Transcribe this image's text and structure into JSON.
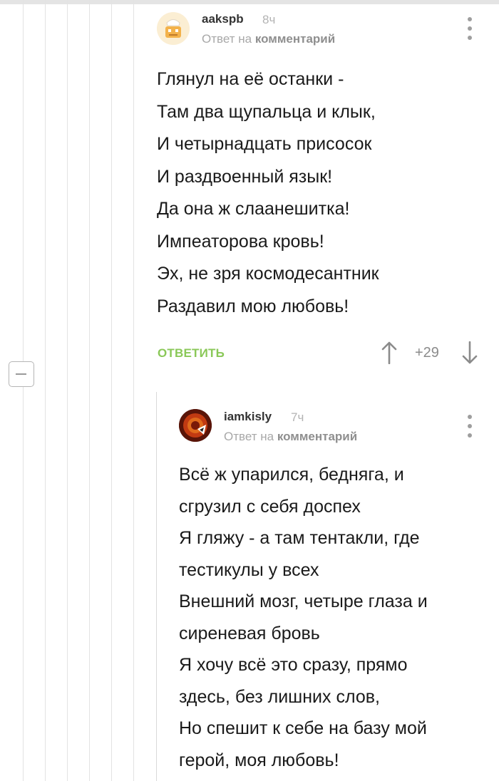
{
  "comment1": {
    "username": "aakspb",
    "time": "8ч",
    "reply_prefix": "Ответ на",
    "reply_link": "комментарий",
    "lines": [
      "Глянул на её останки -",
      "Там два щупальца и клык,",
      "И четырнадцать присосок",
      "И раздвоенный язык!",
      "Да она ж слаанешитка!",
      "Импеаторова кровь!",
      "Эх, не зря космодесантник",
      "Раздавил мою любовь!"
    ],
    "reply_button": "ОТВЕТИТЬ",
    "score": "+29"
  },
  "comment2": {
    "username": "iamkisly",
    "time": "7ч",
    "reply_prefix": "Ответ на",
    "reply_link": "комментарий",
    "lines": [
      "Всё ж упарился, бедняга, и",
      "сгрузил с себя доспех",
      "Я гляжу - а там тентакли, где",
      "тестикулы у всех",
      "Внешний мозг, четыре глаза и",
      "сиреневая бровь",
      "Я хочу всё это сразу, прямо",
      "здесь, без лишних слов,",
      "Но спешит к себе на базу мой",
      "герой, моя любовь!"
    ]
  },
  "icons": {
    "menu": "vertical-dots-icon",
    "upvote": "arrow-up-icon",
    "downvote": "arrow-down-icon",
    "collapse": "minus-icon"
  },
  "colors": {
    "reply_button": "#8ac858",
    "meta_text": "#a8a8a8",
    "thread_lines": "#e3e3e3"
  }
}
